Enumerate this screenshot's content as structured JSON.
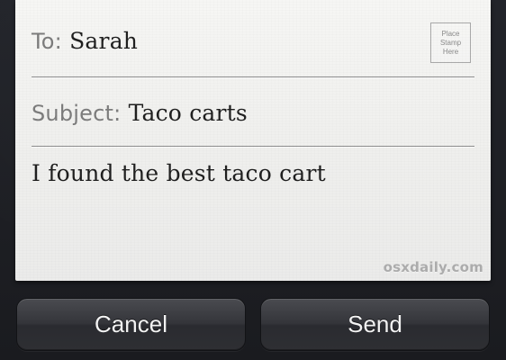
{
  "message": {
    "to_label": "To:",
    "to_value": "Sarah",
    "subject_label": "Subject:",
    "subject_value": "Taco carts",
    "body_text": "I found the best taco cart"
  },
  "stamp": {
    "line1": "Place",
    "line2": "Stamp",
    "line3": "Here"
  },
  "watermark": "osxdaily.com",
  "actions": {
    "cancel_label": "Cancel",
    "send_label": "Send"
  }
}
